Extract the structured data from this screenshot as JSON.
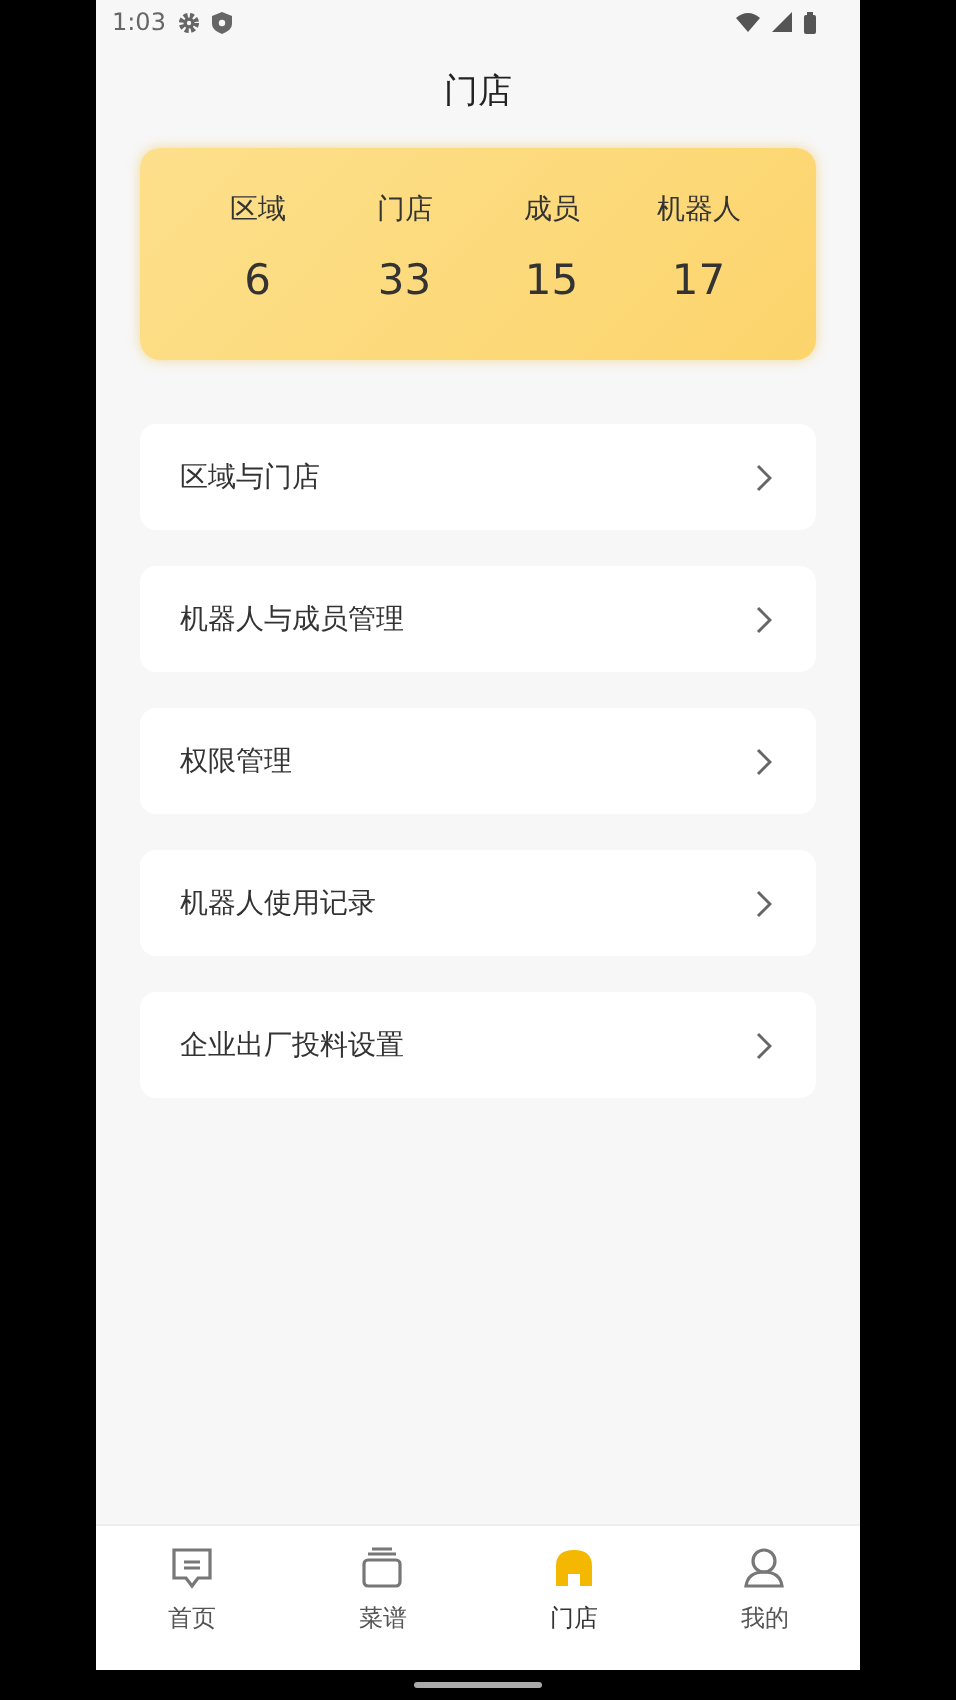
{
  "status_bar": {
    "time": "1:03"
  },
  "title": "门店",
  "stats": [
    {
      "label": "区域",
      "value": "6"
    },
    {
      "label": "门店",
      "value": "33"
    },
    {
      "label": "成员",
      "value": "15"
    },
    {
      "label": "机器人",
      "value": "17"
    }
  ],
  "menu": [
    "区域与门店",
    "机器人与成员管理",
    "权限管理",
    "机器人使用记录",
    "企业出厂投料设置"
  ],
  "tabs": [
    {
      "label": "首页",
      "selected": false
    },
    {
      "label": "菜谱",
      "selected": false
    },
    {
      "label": "门店",
      "selected": true
    },
    {
      "label": "我的",
      "selected": false
    }
  ]
}
